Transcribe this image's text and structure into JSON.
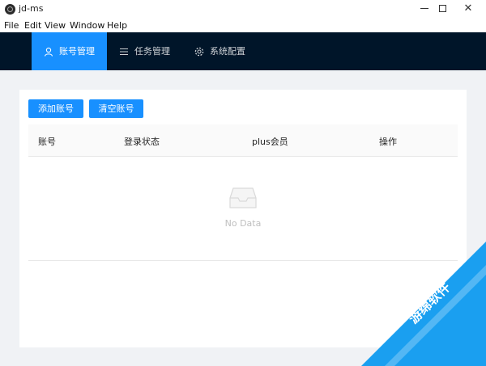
{
  "window": {
    "title": "jd-ms"
  },
  "menu": [
    "File",
    "Edit",
    "View",
    "Window",
    "Help"
  ],
  "nav": {
    "tabs": [
      {
        "label": "账号管理",
        "icon": "user-icon",
        "active": true
      },
      {
        "label": "任务管理",
        "icon": "list-icon",
        "active": false
      },
      {
        "label": "系统配置",
        "icon": "gear-icon",
        "active": false
      }
    ]
  },
  "toolbar": {
    "add_label": "添加账号",
    "clear_label": "清空账号"
  },
  "table": {
    "columns": [
      "账号",
      "登录状态",
      "plus会员",
      "操作"
    ],
    "rows": [],
    "empty_text": "No Data"
  },
  "watermark": {
    "text": "游绵软件"
  },
  "colors": {
    "accent": "#1890ff",
    "nav_bg": "#001529",
    "page_bg": "#f0f2f5"
  }
}
